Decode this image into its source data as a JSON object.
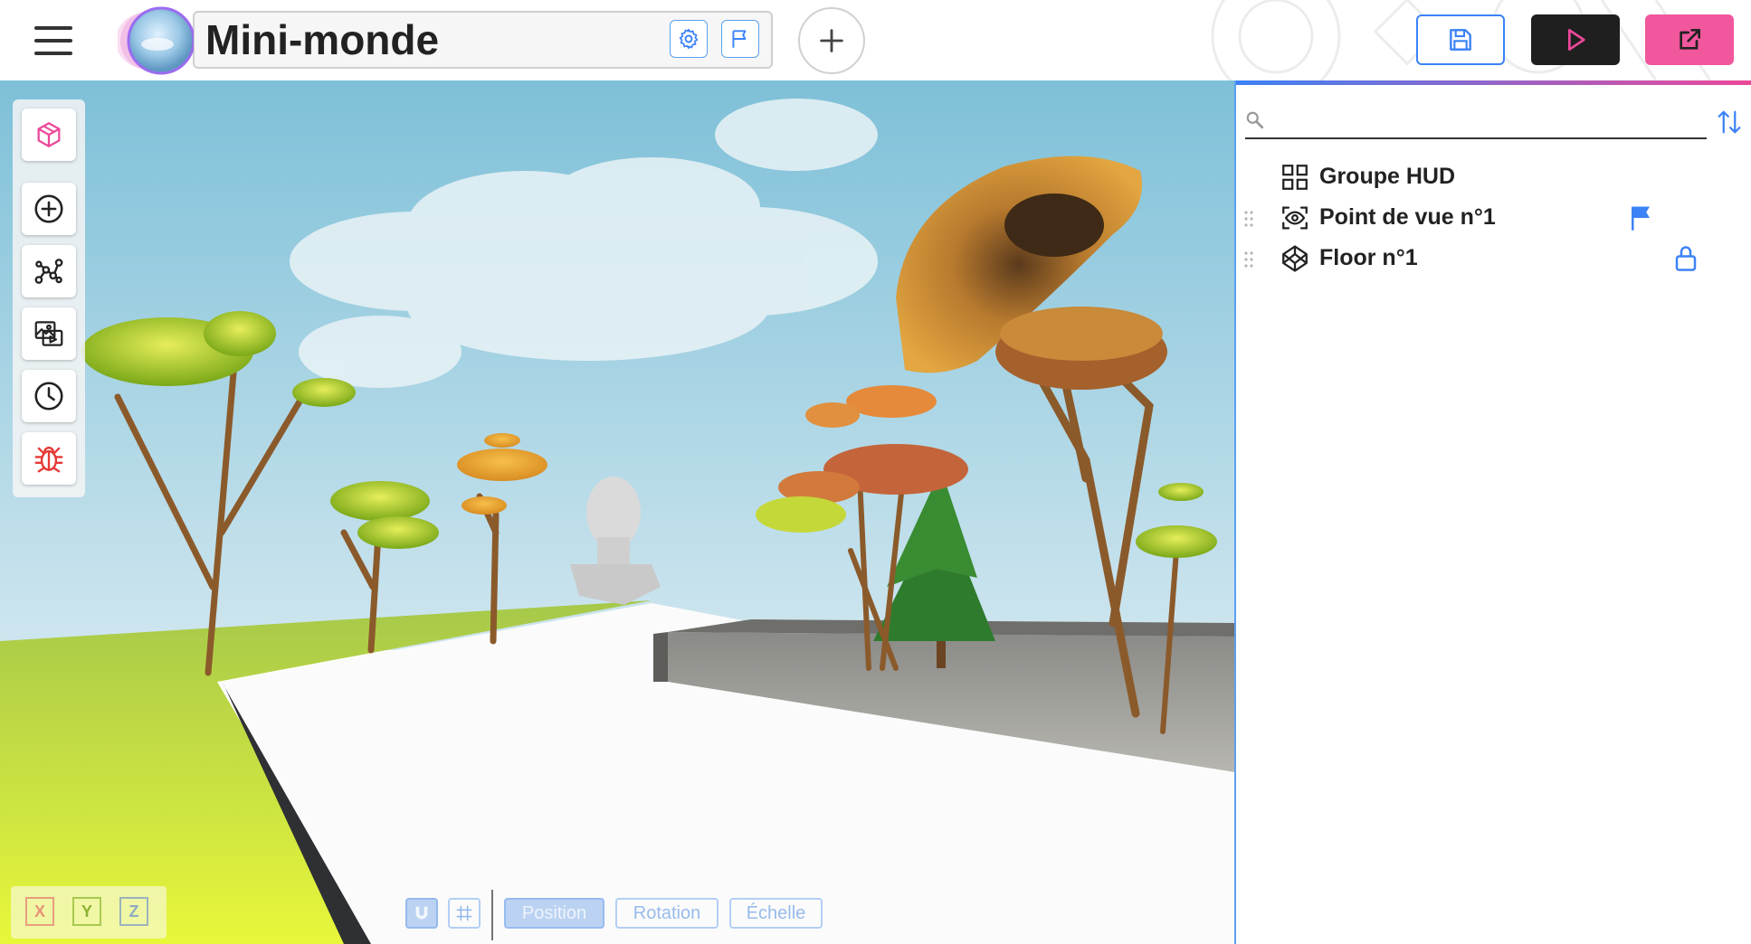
{
  "header": {
    "title": "Mini-monde",
    "menu_icon": "hamburger-icon",
    "settings_icon": "gear-icon",
    "flag_icon": "flag-icon",
    "add_icon": "plus-icon",
    "save_icon": "save-icon",
    "play_icon": "play-icon",
    "share_icon": "external-link-icon"
  },
  "colors": {
    "accent_blue": "#3b82f6",
    "accent_pink": "#ec4899",
    "play_bg": "#1f1f1f",
    "share_bg": "#f1579c"
  },
  "toolbar": {
    "tools": [
      {
        "name": "objects",
        "icon": "cube-icon"
      },
      {
        "name": "add",
        "icon": "plus-circle-icon"
      },
      {
        "name": "graph",
        "icon": "graph-icon"
      },
      {
        "name": "media",
        "icon": "images-icon"
      },
      {
        "name": "history",
        "icon": "clock-icon"
      },
      {
        "name": "debug",
        "icon": "bug-icon"
      }
    ]
  },
  "axes": {
    "x": "X",
    "y": "Y",
    "z": "Z"
  },
  "transform": {
    "position": "Position",
    "rotation": "Rotation",
    "scale": "Échelle"
  },
  "panel": {
    "search_placeholder": "",
    "items": [
      {
        "label": "Groupe HUD",
        "icon": "grid-icon",
        "badge": ""
      },
      {
        "label": "Point de vue n°1",
        "icon": "eye-icon",
        "badge": "flag-icon"
      },
      {
        "label": "Floor n°1",
        "icon": "codepen-icon",
        "badge": "lock-icon"
      }
    ]
  }
}
